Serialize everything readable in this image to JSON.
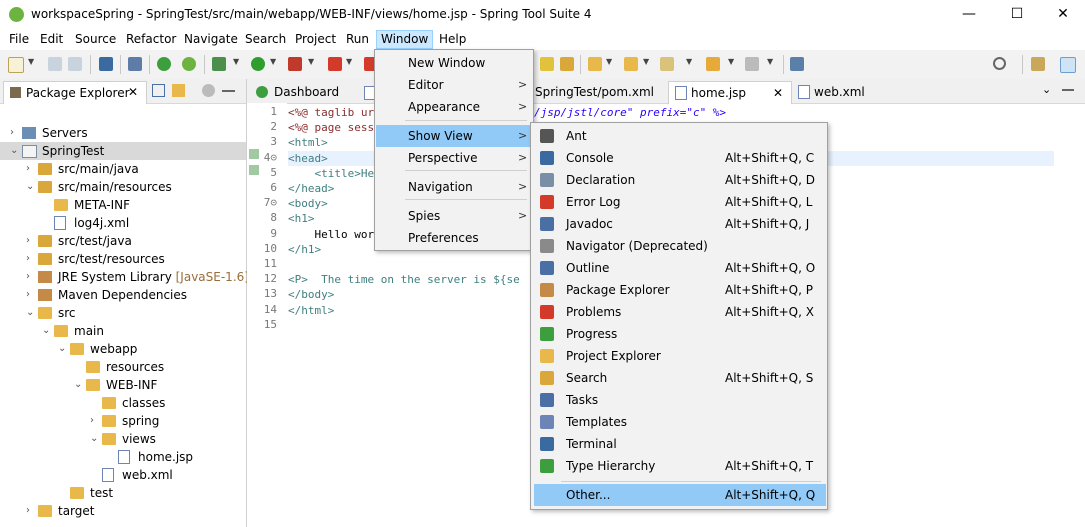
{
  "window": {
    "title": "workspaceSpring - SpringTest/src/main/webapp/WEB-INF/views/home.jsp - Spring Tool Suite 4",
    "minimize": "—",
    "maximize": "☐",
    "close": "✕"
  },
  "menubar": {
    "items": [
      "File",
      "Edit",
      "Source",
      "Refactor",
      "Navigate",
      "Search",
      "Project",
      "Run",
      "Window",
      "Help"
    ]
  },
  "package_explorer": {
    "title": "Package Explorer",
    "close": "✕",
    "tree": [
      {
        "label": "Servers",
        "extra": ""
      },
      {
        "label": "SpringTest",
        "extra": ""
      },
      {
        "label": "src/main/java",
        "extra": ""
      },
      {
        "label": "src/main/resources",
        "extra": ""
      },
      {
        "label": "META-INF",
        "extra": ""
      },
      {
        "label": "log4j.xml",
        "extra": ""
      },
      {
        "label": "src/test/java",
        "extra": ""
      },
      {
        "label": "src/test/resources",
        "extra": ""
      },
      {
        "label": "JRE System Library",
        "extra": "[JavaSE-1.6]"
      },
      {
        "label": "Maven Dependencies",
        "extra": ""
      },
      {
        "label": "src",
        "extra": ""
      },
      {
        "label": "main",
        "extra": ""
      },
      {
        "label": "webapp",
        "extra": ""
      },
      {
        "label": "resources",
        "extra": ""
      },
      {
        "label": "WEB-INF",
        "extra": ""
      },
      {
        "label": "classes",
        "extra": ""
      },
      {
        "label": "spring",
        "extra": ""
      },
      {
        "label": "views",
        "extra": ""
      },
      {
        "label": "home.jsp",
        "extra": ""
      },
      {
        "label": "web.xml",
        "extra": ""
      },
      {
        "label": "test",
        "extra": ""
      },
      {
        "label": "target",
        "extra": ""
      }
    ]
  },
  "editor": {
    "tabs": [
      "Dashboard",
      "SpringTest/pom.xml",
      "home.jsp",
      "web.xml"
    ],
    "active_tab": "home.jsp",
    "line_numbers": [
      "1",
      "2",
      "3",
      "4⊝",
      "5",
      "6",
      "7⊝",
      "8",
      "9",
      "10",
      "11",
      "12",
      "13",
      "14",
      "15"
    ],
    "lines": [
      "<%@ taglib ur",
      "<%@ page sess",
      "<html>",
      "<head>",
      "    <title>He",
      "</head>",
      "<body>",
      "<h1>",
      "    Hello wor",
      "</h1>",
      "",
      "<P>  The time on the server is ${se",
      "</body>",
      "</html>",
      ""
    ],
    "overflow_line1": "/jsp/jstl/core\" prefix=\"c\" %>"
  },
  "window_menu": {
    "items": [
      {
        "label": "New Window",
        "submenu": false
      },
      {
        "label": "Editor",
        "submenu": true
      },
      {
        "label": "Appearance",
        "submenu": true
      },
      {
        "label": "Show View",
        "submenu": true
      },
      {
        "label": "Perspective",
        "submenu": true
      },
      {
        "label": "Navigation",
        "submenu": true
      },
      {
        "label": "Spies",
        "submenu": true
      },
      {
        "label": "Preferences",
        "submenu": false
      }
    ],
    "arrow": ">"
  },
  "show_view_menu": {
    "items": [
      {
        "label": "Ant",
        "shortcut": "",
        "icon": "ant-icon"
      },
      {
        "label": "Console",
        "shortcut": "Alt+Shift+Q, C",
        "icon": "console-icon"
      },
      {
        "label": "Declaration",
        "shortcut": "Alt+Shift+Q, D",
        "icon": "declaration-icon"
      },
      {
        "label": "Error Log",
        "shortcut": "Alt+Shift+Q, L",
        "icon": "error-log-icon"
      },
      {
        "label": "Javadoc",
        "shortcut": "Alt+Shift+Q, J",
        "icon": "javadoc-icon"
      },
      {
        "label": "Navigator (Deprecated)",
        "shortcut": "",
        "icon": "navigator-icon"
      },
      {
        "label": "Outline",
        "shortcut": "Alt+Shift+Q, O",
        "icon": "outline-icon"
      },
      {
        "label": "Package Explorer",
        "shortcut": "Alt+Shift+Q, P",
        "icon": "package-explorer-icon"
      },
      {
        "label": "Problems",
        "shortcut": "Alt+Shift+Q, X",
        "icon": "problems-icon"
      },
      {
        "label": "Progress",
        "shortcut": "",
        "icon": "progress-icon"
      },
      {
        "label": "Project Explorer",
        "shortcut": "",
        "icon": "project-explorer-icon"
      },
      {
        "label": "Search",
        "shortcut": "Alt+Shift+Q, S",
        "icon": "search-icon"
      },
      {
        "label": "Tasks",
        "shortcut": "",
        "icon": "tasks-icon"
      },
      {
        "label": "Templates",
        "shortcut": "",
        "icon": "templates-icon"
      },
      {
        "label": "Terminal",
        "shortcut": "",
        "icon": "terminal-icon"
      },
      {
        "label": "Type Hierarchy",
        "shortcut": "Alt+Shift+Q, T",
        "icon": "type-hierarchy-icon"
      },
      {
        "label": "Other...",
        "shortcut": "Alt+Shift+Q, Q",
        "icon": ""
      }
    ]
  },
  "colors": {
    "menu_highlight": "#91c9f7",
    "menubar_active": "#cce8ff",
    "spring_green": "#6db33f"
  }
}
